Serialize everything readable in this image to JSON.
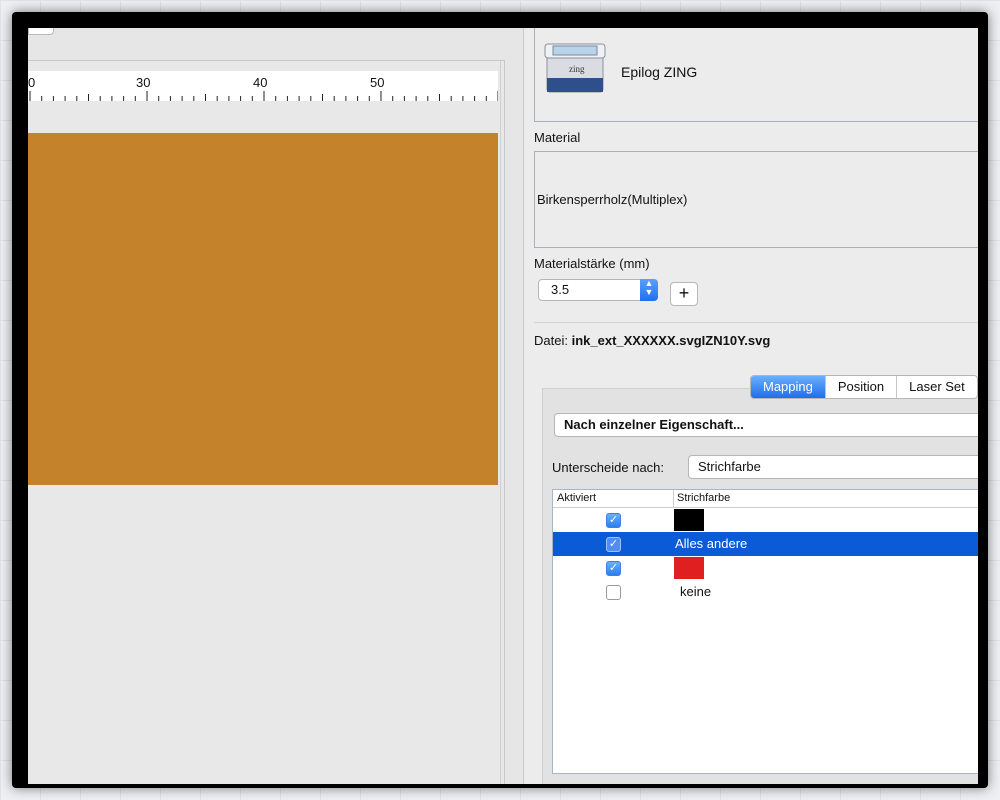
{
  "ruler": {
    "labels": [
      "0",
      "30",
      "40",
      "50"
    ]
  },
  "device": {
    "name": "Epilog ZING",
    "icon_label": "zing"
  },
  "material": {
    "label": "Material",
    "value": "Birkensperrholz(Multiplex)"
  },
  "thickness": {
    "label": "Materialstärke (mm)",
    "value": "3.5",
    "add_label": "+"
  },
  "file": {
    "prefix": "Datei:",
    "name": "ink_ext_XXXXXX.svgIZN10Y.svg"
  },
  "tabs": [
    {
      "label": "Mapping",
      "active": true
    },
    {
      "label": "Position",
      "active": false
    },
    {
      "label": "Laser Set",
      "active": false
    }
  ],
  "mapping": {
    "mode": "Nach einzelner Eigenschaft...",
    "distinguish_label": "Unterscheide nach:",
    "distinguish_value": "Strichfarbe"
  },
  "table": {
    "columns": [
      "Aktiviert",
      "Strichfarbe"
    ],
    "rows": [
      {
        "checked": true,
        "color": "#000000",
        "text": ""
      },
      {
        "checked": true,
        "color": "",
        "text": "Alles andere",
        "selected": true
      },
      {
        "checked": true,
        "color": "#e02020",
        "text": ""
      },
      {
        "checked": false,
        "color": "",
        "text": "keine"
      }
    ]
  },
  "colors": {
    "work_area": "#c4832a",
    "accent": "#1e6fe8",
    "selection": "#0b5bd7"
  }
}
